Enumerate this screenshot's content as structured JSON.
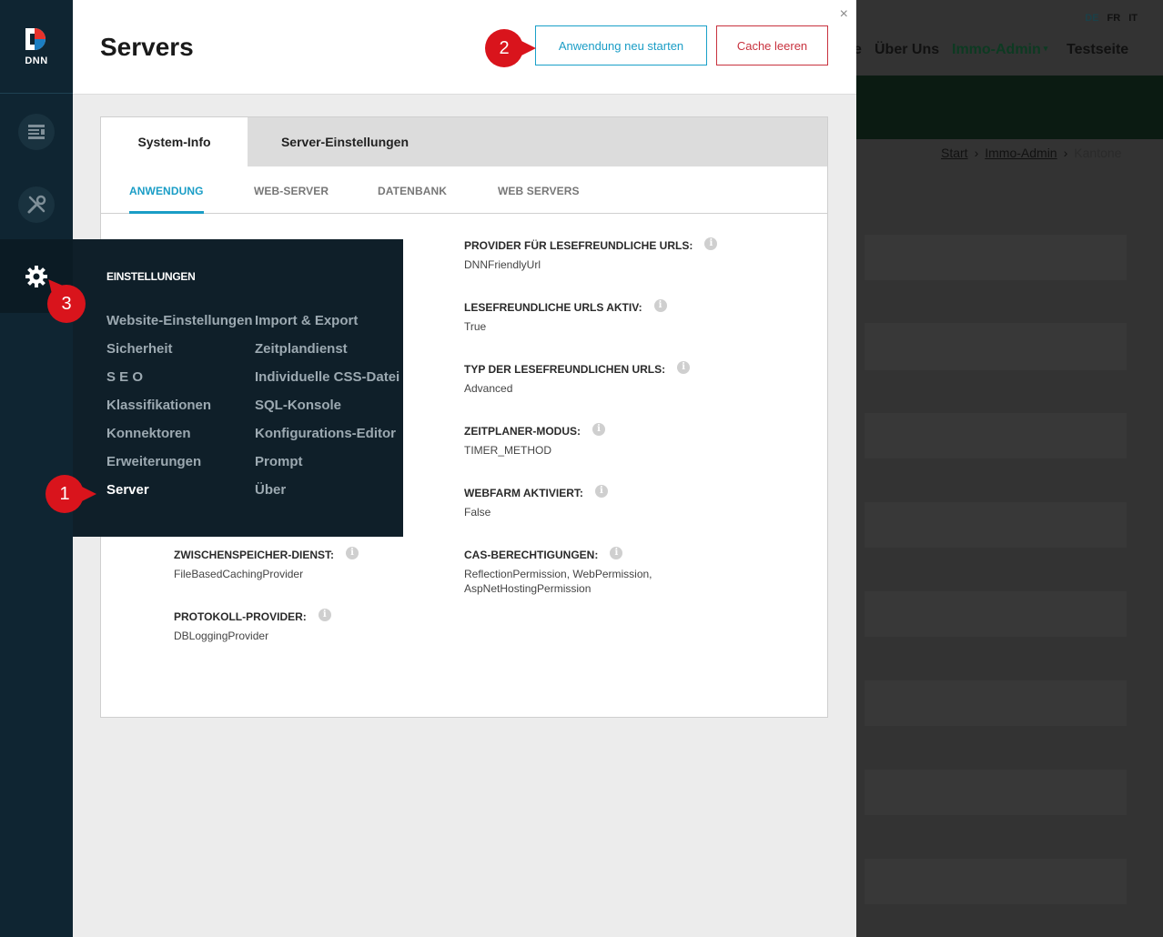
{
  "background": {
    "languages": [
      "DE",
      "FR",
      "IT"
    ],
    "nav": [
      "e",
      "Über Uns",
      "Immo-Admin",
      "Testseite"
    ],
    "breadcrumb": [
      "Start",
      "Immo-Admin",
      "Kantone"
    ],
    "breadcrumb_sep": "›"
  },
  "sidebar": {
    "logo_text": "DNN",
    "icons": [
      "content-icon",
      "tools-icon",
      "settings-gear-icon"
    ]
  },
  "panel": {
    "title": "Servers",
    "close": "×",
    "restart_button": "Anwendung neu starten",
    "cache_button": "Cache leeren",
    "tabs": [
      "System-Info",
      "Server-Einstellungen"
    ],
    "subtabs": [
      "ANWENDUNG",
      "WEB-SERVER",
      "DATENBANK",
      "WEB SERVERS"
    ],
    "left_fields": [
      {
        "label": "ZWISCHENSPEICHER-DIENST:",
        "value": "FileBasedCachingProvider"
      },
      {
        "label": "PROTOKOLL-PROVIDER:",
        "value": "DBLoggingProvider"
      }
    ],
    "right_fields": [
      {
        "label": "PROVIDER FÜR LESEFREUNDLICHE URLS:",
        "value": "DNNFriendlyUrl"
      },
      {
        "label": "LESEFREUNDLICHE URLS AKTIV:",
        "value": "True"
      },
      {
        "label": "TYP DER LESEFREUNDLICHEN URLS:",
        "value": "Advanced"
      },
      {
        "label": "ZEITPLANER-MODUS:",
        "value": "TIMER_METHOD"
      },
      {
        "label": "WEBFARM AKTIVIERT:",
        "value": "False"
      },
      {
        "label": "CAS-BERECHTIGUNGEN:",
        "value": "ReflectionPermission, WebPermission,",
        "value2": "AspNetHostingPermission"
      }
    ],
    "info_glyph": "i"
  },
  "flyout": {
    "heading": "EINSTELLUNGEN",
    "col1": [
      "Website-Einstellungen",
      "Sicherheit",
      "S E O",
      "Klassifikationen",
      "Konnektoren",
      "Erweiterungen",
      "Server"
    ],
    "col2": [
      "Import & Export",
      "Zeitplandienst",
      "Individuelle CSS-Datei",
      "SQL-Konsole",
      "Konfigurations-Editor",
      "Prompt",
      "Über"
    ]
  },
  "callouts": [
    "1",
    "2",
    "3"
  ],
  "colors": {
    "accent": "#1a9dc6",
    "danger": "#c8323e",
    "sidebar": "#0f2532",
    "callout": "#d9141c"
  }
}
